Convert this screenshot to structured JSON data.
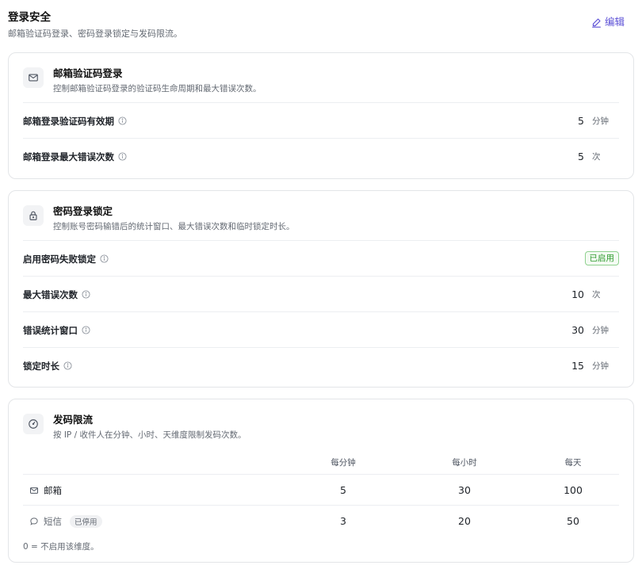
{
  "header": {
    "title": "登录安全",
    "subtitle": "邮箱验证码登录、密码登录锁定与发码限流。",
    "edit_label": "编辑",
    "edit_icon": "pencil-icon",
    "accent_color": "#5b4fd6"
  },
  "email_card": {
    "icon": "mail-icon",
    "title": "邮箱验证码登录",
    "desc": "控制邮箱验证码登录的验证码生命周期和最大错误次数。",
    "rows": [
      {
        "label": "邮箱登录验证码有效期",
        "value": "5",
        "unit": "分钟"
      },
      {
        "label": "邮箱登录最大错误次数",
        "value": "5",
        "unit": "次"
      }
    ]
  },
  "lock_card": {
    "icon": "lock-icon",
    "title": "密码登录锁定",
    "desc": "控制账号密码输错后的统计窗口、最大错误次数和临时锁定时长。",
    "enable_label": "启用密码失败锁定",
    "enable_status": "已启用",
    "status_color": "#2e9b2e",
    "rows": [
      {
        "label": "最大错误次数",
        "value": "10",
        "unit": "次"
      },
      {
        "label": "错误统计窗口",
        "value": "30",
        "unit": "分钟"
      },
      {
        "label": "锁定时长",
        "value": "15",
        "unit": "分钟"
      }
    ]
  },
  "ratelimit_card": {
    "icon": "gauge-icon",
    "title": "发码限流",
    "desc": "按 IP / 收件人在分钟、小时、天维度限制发码次数。",
    "columns": [
      "每分钟",
      "每小时",
      "每天"
    ],
    "rows": [
      {
        "channel": "邮箱",
        "icon": "mail-icon",
        "badge": "",
        "values": [
          "5",
          "30",
          "100"
        ]
      },
      {
        "channel": "短信",
        "icon": "chat-bubble-icon",
        "badge": "已停用",
        "values": [
          "3",
          "20",
          "50"
        ]
      }
    ],
    "note": "0 = 不启用该维度。"
  }
}
